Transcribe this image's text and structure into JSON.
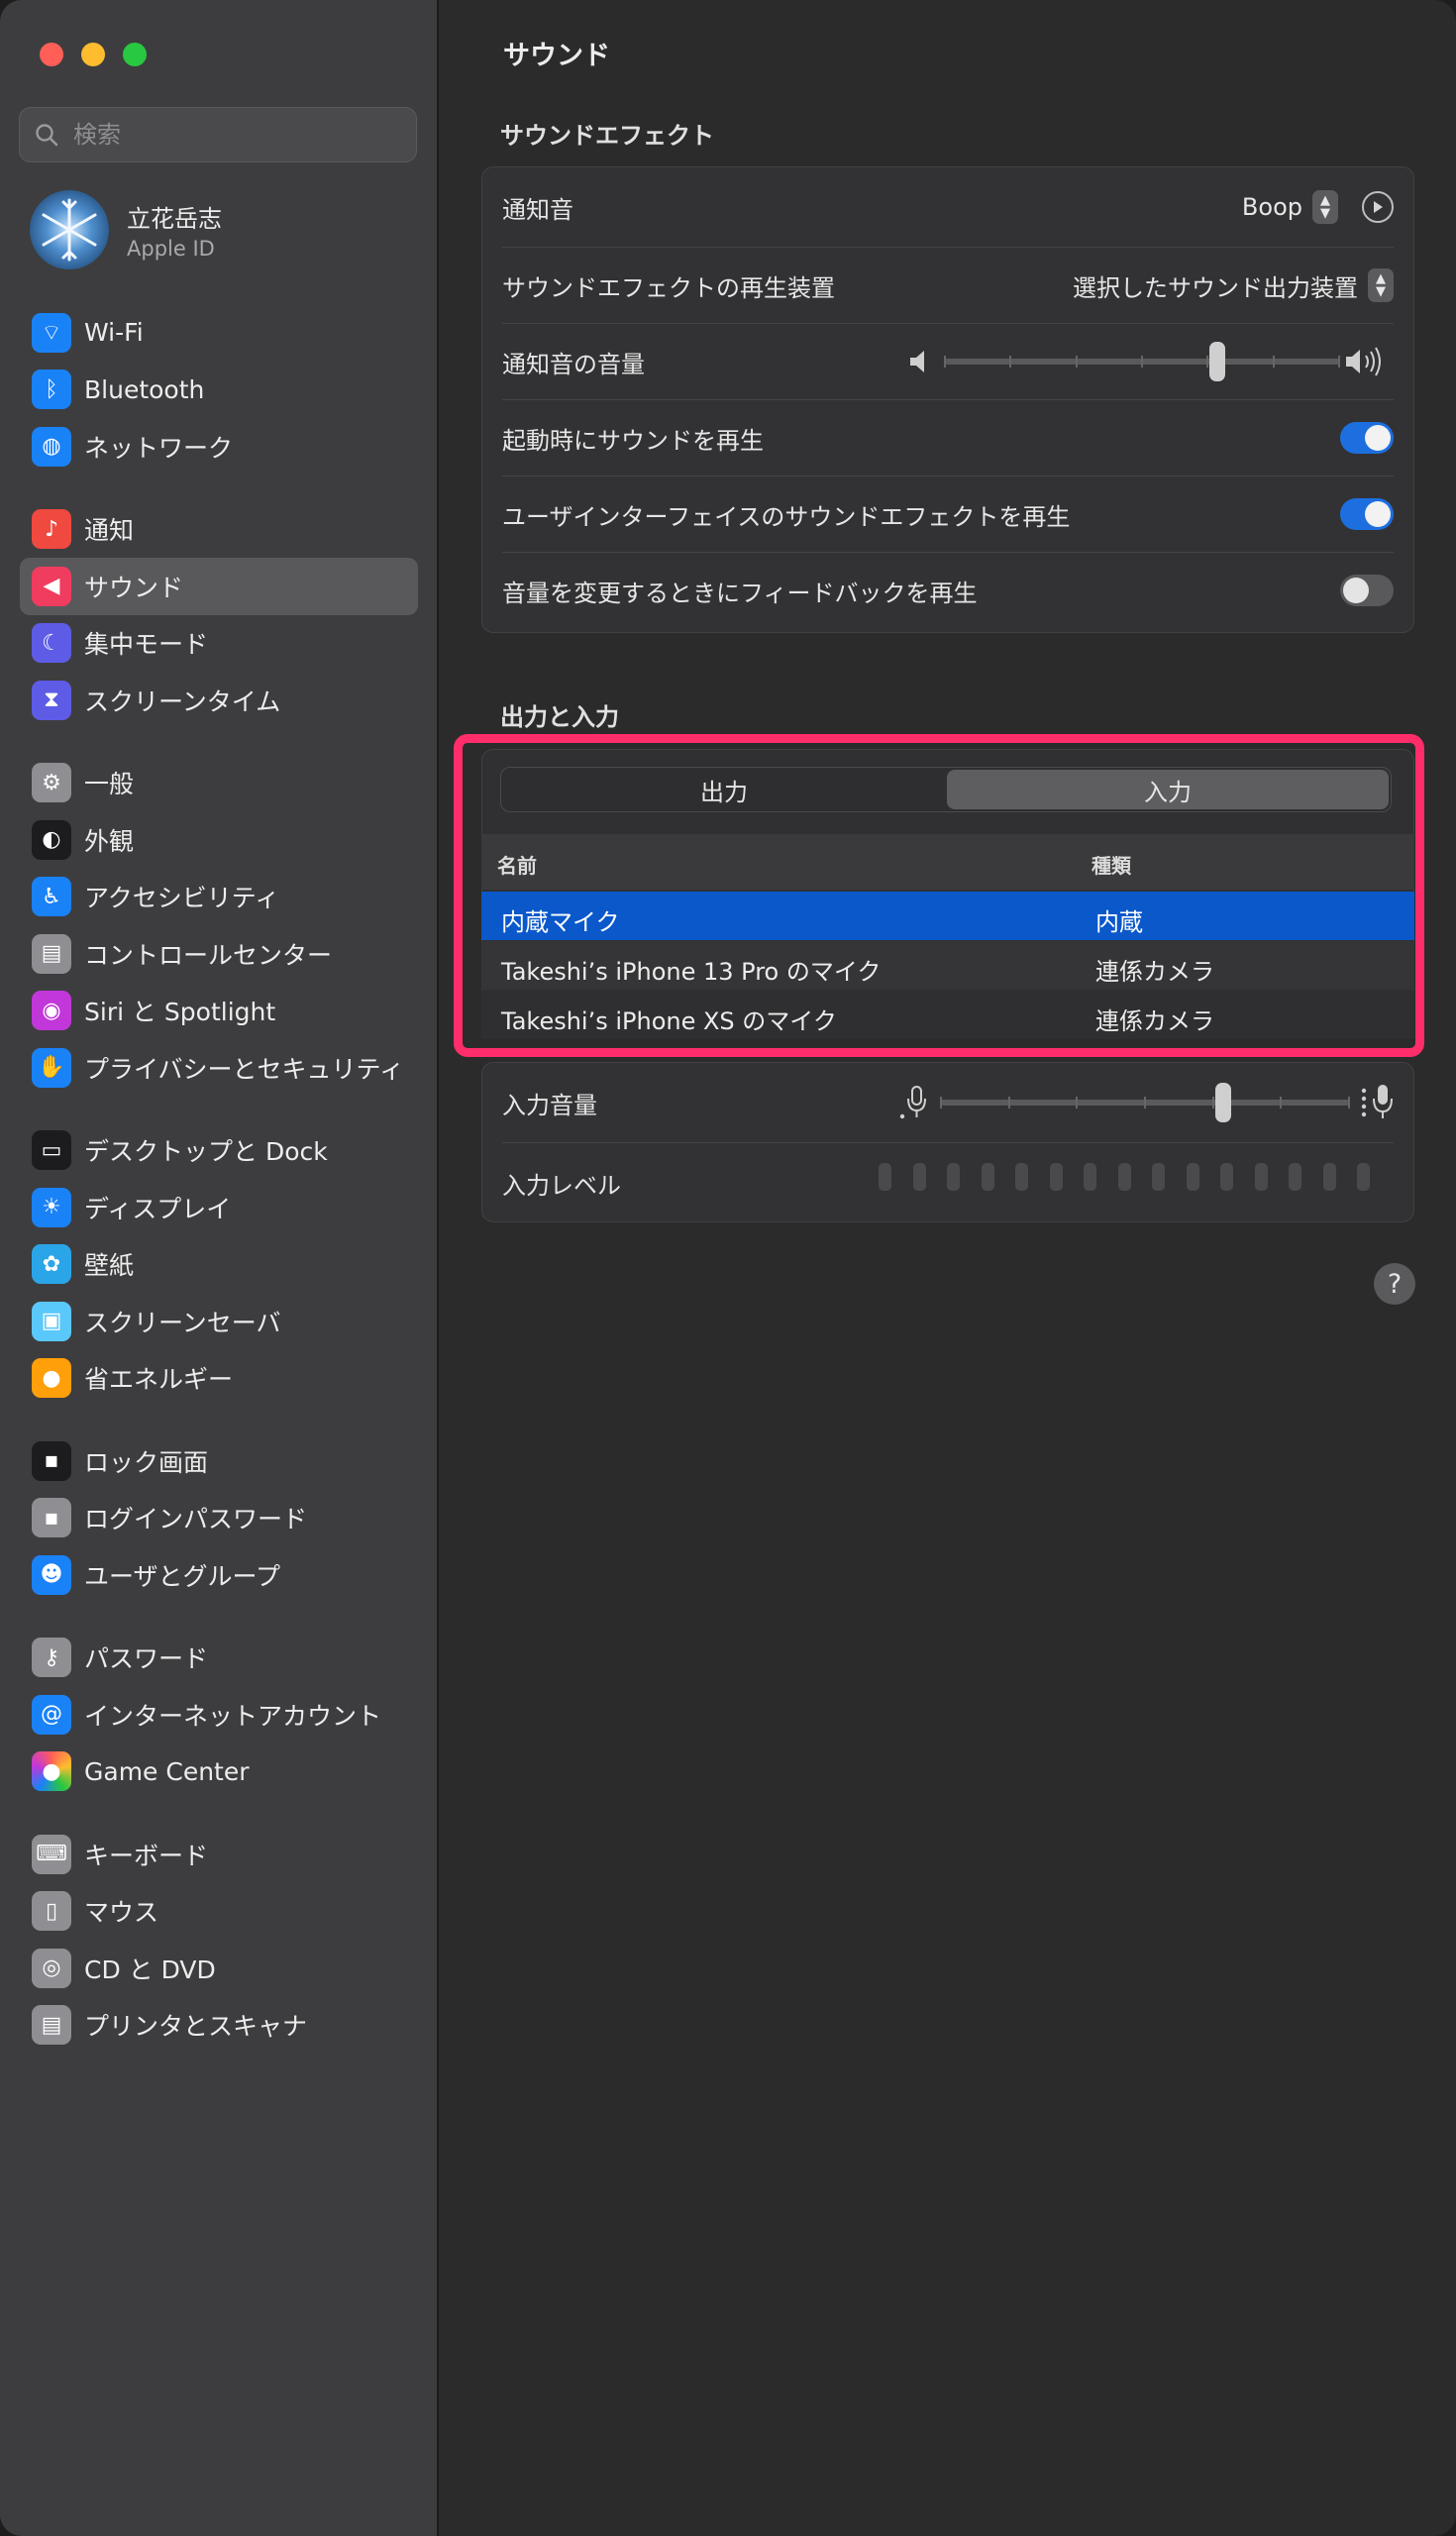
{
  "window": {
    "title": "サウンド"
  },
  "sidebar": {
    "search_placeholder": "検索",
    "profile": {
      "name": "立花岳志",
      "subtitle": "Apple ID"
    },
    "groups": [
      [
        {
          "label": "Wi-Fi",
          "icon": "wifi-icon",
          "color": "#1a82f7"
        },
        {
          "label": "Bluetooth",
          "icon": "bluetooth-icon",
          "color": "#1a82f7"
        },
        {
          "label": "ネットワーク",
          "icon": "globe-icon",
          "color": "#1a82f7"
        }
      ],
      [
        {
          "label": "通知",
          "icon": "bell-icon",
          "color": "#f0493f"
        },
        {
          "label": "サウンド",
          "icon": "speaker-icon",
          "color": "#f03c5f",
          "active": true
        },
        {
          "label": "集中モード",
          "icon": "moon-icon",
          "color": "#5e5ce6"
        },
        {
          "label": "スクリーンタイム",
          "icon": "hourglass-icon",
          "color": "#5e5ce6"
        }
      ],
      [
        {
          "label": "一般",
          "icon": "gear-icon",
          "color": "#8e8e93"
        },
        {
          "label": "外観",
          "icon": "appearance-icon",
          "color": "#1c1c1e"
        },
        {
          "label": "アクセシビリティ",
          "icon": "accessibility-icon",
          "color": "#1a82f7"
        },
        {
          "label": "コントロールセンター",
          "icon": "control-center-icon",
          "color": "#8e8e93"
        },
        {
          "label": "Siri と Spotlight",
          "icon": "siri-icon",
          "color": "#c137d9"
        },
        {
          "label": "プライバシーとセキュリティ",
          "icon": "hand-icon",
          "color": "#1a82f7"
        }
      ],
      [
        {
          "label": "デスクトップと Dock",
          "icon": "dock-icon",
          "color": "#1c1c1e"
        },
        {
          "label": "ディスプレイ",
          "icon": "sun-icon",
          "color": "#1a82f7"
        },
        {
          "label": "壁紙",
          "icon": "flower-icon",
          "color": "#2aa6e8"
        },
        {
          "label": "スクリーンセーバ",
          "icon": "screensaver-icon",
          "color": "#5ac8fa"
        },
        {
          "label": "省エネルギー",
          "icon": "bulb-icon",
          "color": "#ff9f0a"
        }
      ],
      [
        {
          "label": "ロック画面",
          "icon": "lock-screen-icon",
          "color": "#1c1c1e"
        },
        {
          "label": "ログインパスワード",
          "icon": "lock-icon",
          "color": "#8e8e93"
        },
        {
          "label": "ユーザとグループ",
          "icon": "users-icon",
          "color": "#1a82f7"
        }
      ],
      [
        {
          "label": "パスワード",
          "icon": "key-icon",
          "color": "#8e8e93"
        },
        {
          "label": "インターネットアカウント",
          "icon": "at-icon",
          "color": "#1a82f7"
        },
        {
          "label": "Game Center",
          "icon": "game-center-icon",
          "color": "#ffffff"
        }
      ],
      [
        {
          "label": "キーボード",
          "icon": "keyboard-icon",
          "color": "#8e8e93"
        },
        {
          "label": "マウス",
          "icon": "mouse-icon",
          "color": "#8e8e93"
        },
        {
          "label": "CD と DVD",
          "icon": "disc-icon",
          "color": "#8e8e93"
        },
        {
          "label": "プリンタとスキャナ",
          "icon": "printer-icon",
          "color": "#8e8e93"
        }
      ]
    ]
  },
  "main": {
    "title": "サウンド",
    "effects": {
      "heading": "サウンドエフェクト",
      "alert_sound_label": "通知音",
      "alert_sound_value": "Boop",
      "play_device_label": "サウンドエフェクトの再生装置",
      "play_device_value": "選択したサウンド出力装置",
      "alert_volume_label": "通知音の音量",
      "alert_volume_level": 0.69,
      "startup_label": "起動時にサウンドを再生",
      "startup_on": true,
      "ui_effects_label": "ユーザインターフェイスのサウンドエフェクトを再生",
      "ui_effects_on": true,
      "feedback_label": "音量を変更するときにフィードバックを再生",
      "feedback_on": false
    },
    "io": {
      "heading": "出力と入力",
      "tabs": [
        "出力",
        "入力"
      ],
      "selected_tab": "入力",
      "columns": [
        "名前",
        "種類"
      ],
      "rows": [
        {
          "name": "内蔵マイク",
          "type": "内蔵",
          "selected": true
        },
        {
          "name": "Takeshi’s iPhone 13 Pro のマイク",
          "type": "連係カメラ"
        },
        {
          "name": "Takeshi’s iPhone XS のマイク",
          "type": "連係カメラ"
        }
      ],
      "input_volume_label": "入力音量",
      "input_volume_level": 0.69,
      "input_level_label": "入力レベル",
      "input_level_value": 0
    },
    "help": "?"
  },
  "colors": {
    "accent": "#1d6fe0",
    "highlight": "#ff2d6a",
    "selection": "#0a58ca"
  }
}
